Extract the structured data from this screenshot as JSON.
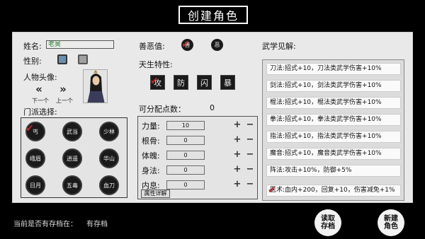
{
  "title": "创建角色",
  "name": {
    "label": "姓名:",
    "value": "老昊"
  },
  "gender": {
    "label": "性别:"
  },
  "portrait": {
    "label": "人物头像:",
    "prev_label": "下一个",
    "next_label": "上一个"
  },
  "sect": {
    "label": "门派选择:",
    "items": [
      "丐",
      "武当",
      "少林",
      "峨眉",
      "逍遥",
      "华山",
      "日月",
      "五毒",
      "血刀"
    ]
  },
  "morality": {
    "label": "善恶值:",
    "good": "善",
    "evil": "恶"
  },
  "traits": {
    "label": "天生特性:",
    "items": [
      "攻",
      "防",
      "闪",
      "暴"
    ]
  },
  "points": {
    "label": "可分配点数：",
    "value": "0"
  },
  "attributes": [
    {
      "label": "力量:",
      "value": "10"
    },
    {
      "label": "根骨:",
      "value": "0"
    },
    {
      "label": "体魄:",
      "value": "0"
    },
    {
      "label": "身法:",
      "value": "0"
    },
    {
      "label": "内息:",
      "value": "0"
    }
  ],
  "plus": "+",
  "minus": "−",
  "detail_button": "属性详解",
  "martial": {
    "label": "武学见解:",
    "items": [
      "刀法:招式+10，刀法类武学伤害+10%",
      "剑法:招式+10，剑法类武学伤害+10%",
      "棍法:招式+10，棍法类武学伤害+10%",
      "拳法:招式+10，拳法类武学伤害+10%",
      "指法:招式+10，指法类武学伤害+10%",
      "魔音:招式+10，魔音类武学伤害+10%",
      "阵法:攻击+10%，防御+5%",
      "医术:血内+200，回复+10，伤害减免+1%"
    ]
  },
  "save_status": {
    "label": "当前是否有存档在：",
    "value": "有存档"
  },
  "load_button": "读取存档",
  "new_button": "新建角色",
  "colors": {
    "check": "#c0282a",
    "name_text": "#2d7b2d"
  }
}
